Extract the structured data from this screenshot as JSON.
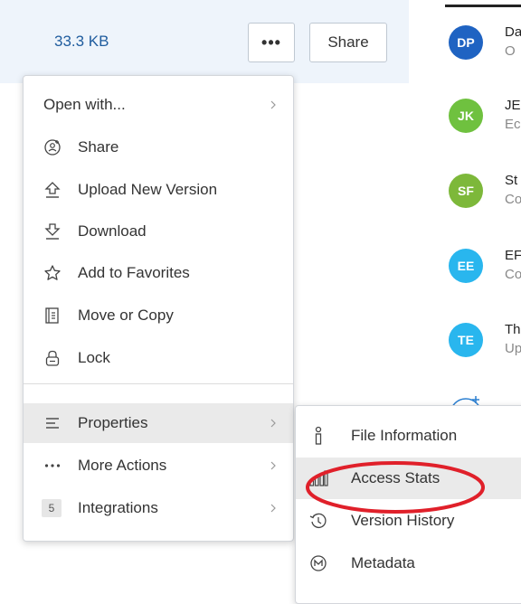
{
  "file_row": {
    "size": "33.3 KB",
    "more_label": "•••",
    "share_label": "Share"
  },
  "activity": [
    {
      "initials": "DP",
      "name": "Da",
      "sub": "O",
      "color": "#1f63c2"
    },
    {
      "initials": "JK",
      "name": "JE",
      "sub": "Ec",
      "color": "#6fc13f"
    },
    {
      "initials": "SF",
      "name": "St",
      "sub": "Co",
      "color": "#7db83a"
    },
    {
      "initials": "EE",
      "name": "EF",
      "sub": "Co",
      "color": "#29b6ee"
    },
    {
      "initials": "TE",
      "name": "Th",
      "sub": "Up",
      "color": "#29b6ee"
    }
  ],
  "menu": {
    "open_with": "Open with...",
    "share": "Share",
    "upload": "Upload New Version",
    "download": "Download",
    "favorites": "Add to Favorites",
    "move_copy": "Move or Copy",
    "lock": "Lock",
    "properties": "Properties",
    "more_actions": "More Actions",
    "integrations": "Integrations",
    "integrations_count": "5"
  },
  "submenu": {
    "file_info": "File Information",
    "access_stats": "Access Stats",
    "version_history": "Version History",
    "metadata": "Metadata"
  },
  "colors": {
    "accent": "#1f5c9e",
    "highlight_ellipse": "#e0202a",
    "hover_bg": "#eaeaea"
  }
}
